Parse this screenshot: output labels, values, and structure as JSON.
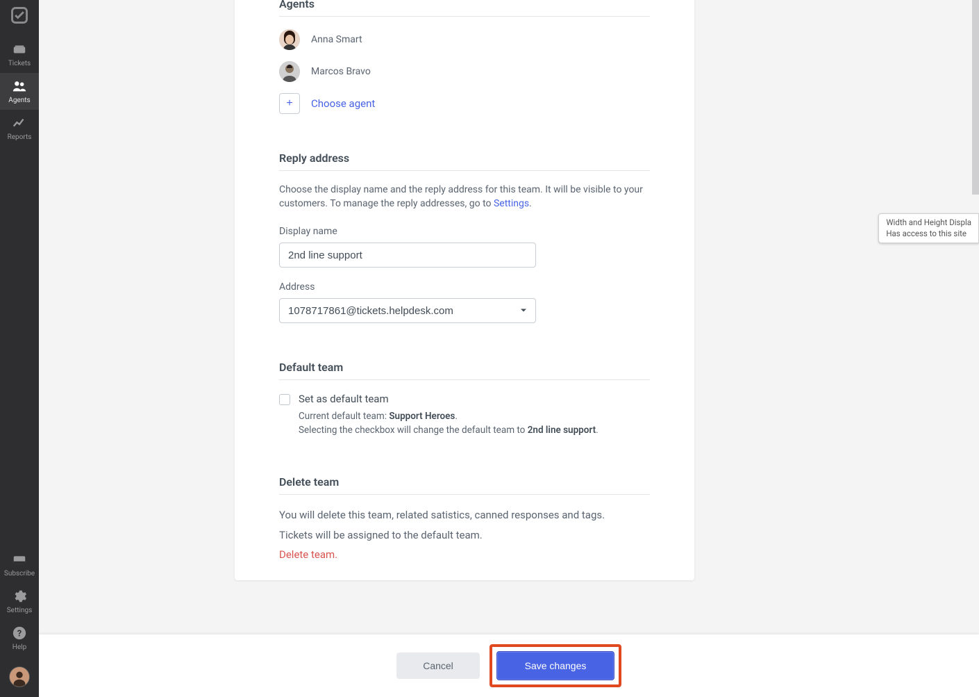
{
  "sidebar": {
    "items": [
      {
        "label": "Tickets"
      },
      {
        "label": "Agents"
      },
      {
        "label": "Reports"
      }
    ],
    "bottom_items": [
      {
        "label": "Subscribe"
      },
      {
        "label": "Settings"
      },
      {
        "label": "Help"
      }
    ]
  },
  "sections": {
    "agents": {
      "title": "Agents",
      "list": [
        {
          "name": "Anna Smart"
        },
        {
          "name": "Marcos Bravo"
        }
      ],
      "choose_label": "Choose agent",
      "plus": "+"
    },
    "reply_address": {
      "title": "Reply address",
      "help_pre": "Choose the display name and the reply address for this team. It will be visible to your customers. To manage the reply addresses, go to ",
      "help_link": "Settings",
      "help_post": ".",
      "display_name_label": "Display name",
      "display_name_value": "2nd line support",
      "address_label": "Address",
      "address_value": "1078717861@tickets.helpdesk.com"
    },
    "default_team": {
      "title": "Default team",
      "checkbox_label": "Set as default team",
      "current_pre": "Current default team: ",
      "current_team": "Support Heroes",
      "current_post": ".",
      "change_pre": "Selecting the checkbox will change the default team to ",
      "change_team": "2nd line support",
      "change_post": "."
    },
    "delete_team": {
      "title": "Delete team",
      "line1": "You will delete this team, related satistics, canned responses and tags.",
      "line2": "Tickets will be assigned to the default team.",
      "link": "Delete team."
    }
  },
  "footer": {
    "cancel": "Cancel",
    "save": "Save changes"
  },
  "tooltip": {
    "line1": "Width and Height Displa",
    "line2": "Has access to this site"
  }
}
